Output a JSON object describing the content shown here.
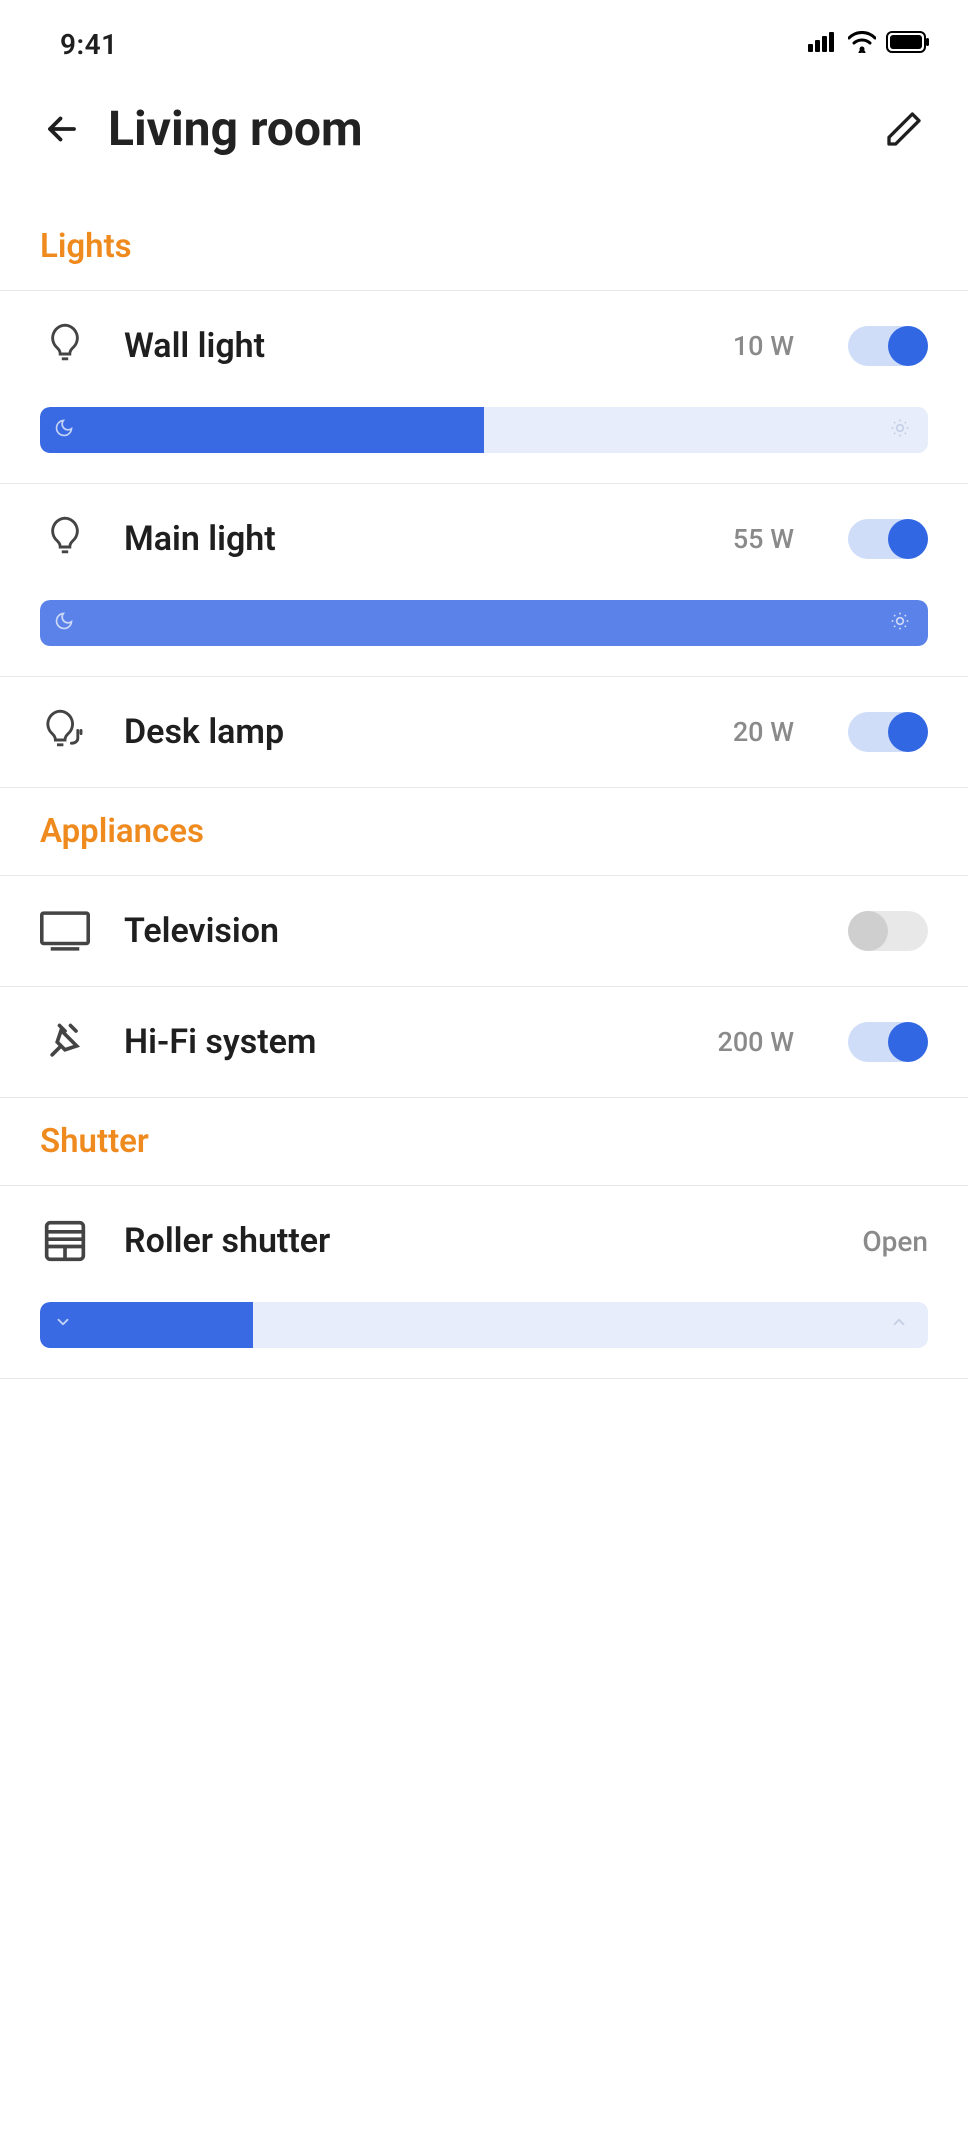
{
  "status": {
    "time": "9:41"
  },
  "header": {
    "title": "Living room"
  },
  "sections": {
    "lights": {
      "label": "Lights",
      "items": [
        {
          "name": "Wall light",
          "power": "10 W",
          "on": true,
          "brightness": 50
        },
        {
          "name": "Main light",
          "power": "55 W",
          "on": true,
          "brightness": 100
        },
        {
          "name": "Desk lamp",
          "power": "20 W",
          "on": true
        }
      ]
    },
    "appliances": {
      "label": "Appliances",
      "items": [
        {
          "name": "Television",
          "on": false
        },
        {
          "name": "Hi-Fi system",
          "power": "200 W",
          "on": true
        }
      ]
    },
    "shutter": {
      "label": "Shutter",
      "items": [
        {
          "name": "Roller shutter",
          "status": "Open",
          "position": 24
        }
      ]
    }
  }
}
